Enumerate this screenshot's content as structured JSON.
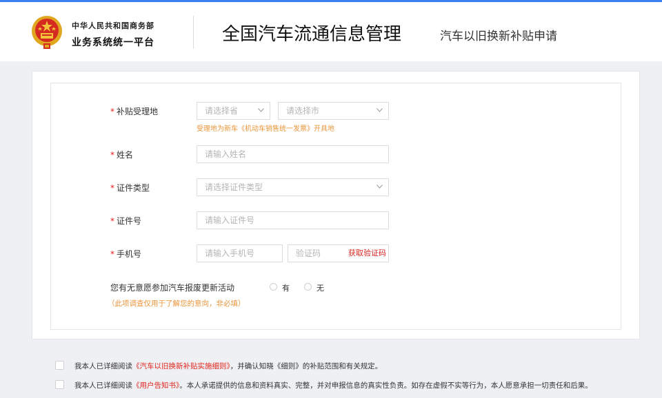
{
  "header": {
    "org_line1": "中华人民共和国商务部",
    "org_line2": "业务系统统一平台",
    "title": "全国汽车流通信息管理",
    "subtitle": "汽车以旧换新补贴申请"
  },
  "form": {
    "location": {
      "label": "补贴受理地",
      "province_placeholder": "请选择省",
      "city_placeholder": "请选择市",
      "hint": "受理地为新车《机动车销售统一发票》开具地"
    },
    "name": {
      "label": "姓名",
      "placeholder": "请输入姓名"
    },
    "id_type": {
      "label": "证件类型",
      "placeholder": "请选择证件类型"
    },
    "id_number": {
      "label": "证件号",
      "placeholder": "请输入证件号"
    },
    "phone": {
      "label": "手机号",
      "placeholder": "请输入手机号",
      "code_placeholder": "验证码",
      "get_code_label": "获取验证码"
    },
    "survey": {
      "question": "您有无意愿参加汽车报废更新活动",
      "note": "（此项调查仅用于了解您的意向，非必填）",
      "option_yes": "有",
      "option_no": "无"
    },
    "required_mark": "*"
  },
  "agreements": [
    {
      "prefix": "我本人已详细阅读",
      "link": "《汽车以旧换新补贴实施细则》",
      "suffix": "，并确认知晓《细则》的补贴范围和有关规定。"
    },
    {
      "prefix": "我本人已详细阅读",
      "link": "《用户告知书》",
      "suffix": "。本人承诺提供的信息和资料真实、完整，并对申报信息的真实性负责。如存在虚假不实等行为，本人愿意承担一切责任和后果。"
    }
  ],
  "colors": {
    "accent": "#3b7ff0",
    "required": "#e2231a",
    "hint": "#e9963b",
    "link": "#e2231a"
  }
}
